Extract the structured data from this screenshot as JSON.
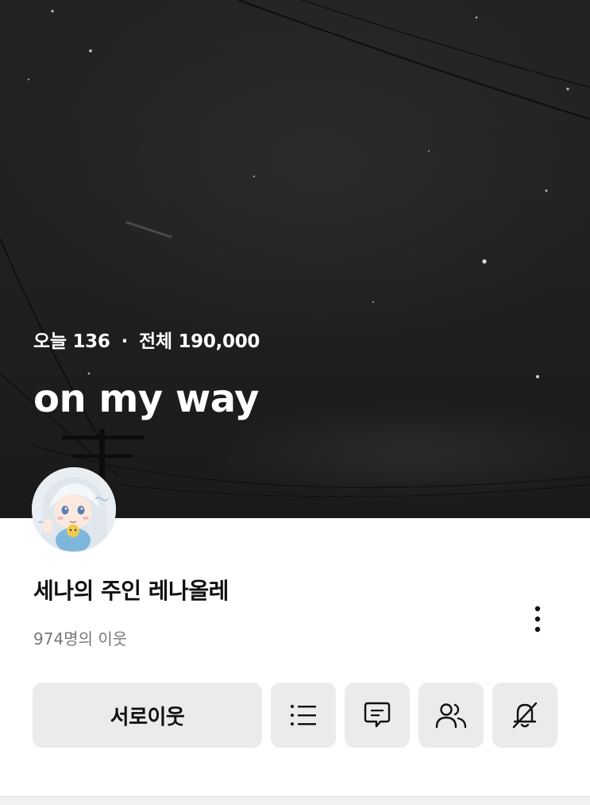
{
  "cover": {
    "stats": {
      "today_label": "오늘",
      "today_count": "136",
      "separator": "·",
      "total_label": "전체",
      "total_count": "190,000"
    },
    "title": "on my way"
  },
  "profile": {
    "nickname": "세나의 주인 레나올레",
    "neighbors_text": "974명의 이웃"
  },
  "actions": {
    "mutual_neighbor_label": "서로이웃",
    "icons": [
      "list-icon",
      "comment-icon",
      "people-icon",
      "notification-off-icon"
    ]
  },
  "more_icon": "more-vertical-icon",
  "colors": {
    "cover_background": "#1f1f1f",
    "button_background": "#ebebeb",
    "title_text": "#ffffff",
    "secondary_text": "#777777"
  }
}
